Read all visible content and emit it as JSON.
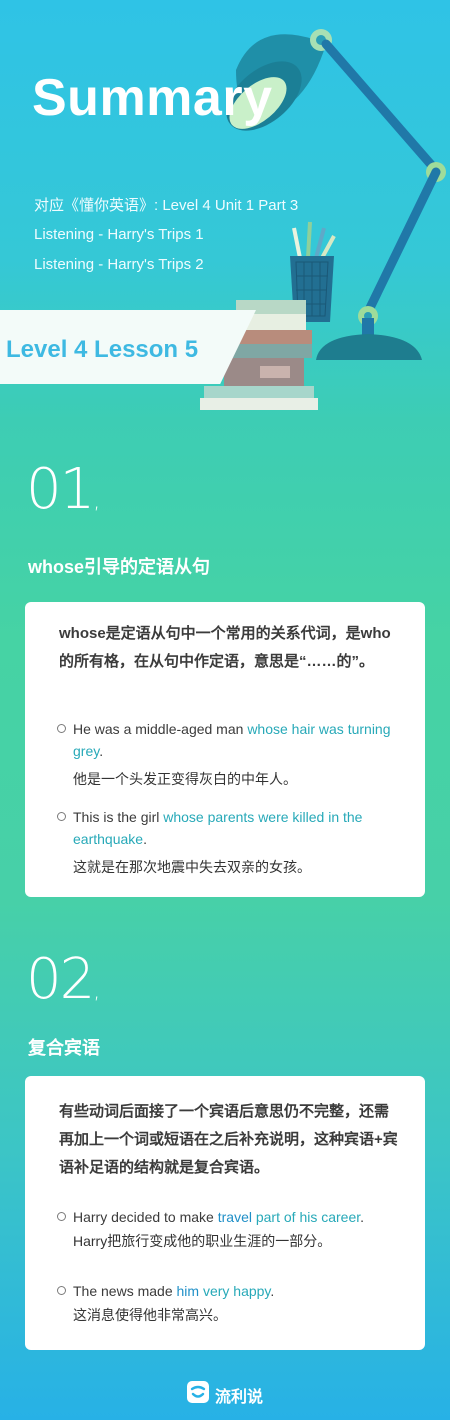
{
  "header": {
    "title": "Summary",
    "course_line": "对应《懂你英语》: Level 4 Unit 1 Part 3",
    "listening_1": "Listening - Harry's Trips 1",
    "listening_2": "Listening - Harry's Trips 2",
    "lesson": "Level 4 Lesson 5"
  },
  "sections": [
    {
      "number": "01",
      "comma": ",",
      "title": "whose引导的定语从句",
      "lead": "whose是定语从句中一个常用的关系代词，是who的所有格，在从句中作定语，意思是“……的”。",
      "examples": [
        {
          "en_before": "He was a middle-aged man ",
          "en_highlight": "whose hair was turning grey",
          "en_after": ".",
          "zh": "他是一个头发正变得灰白的中年人。"
        },
        {
          "en_before": "This is the girl ",
          "en_highlight": "whose parents were killed in the earthquake",
          "en_after": ".",
          "zh": "这就是在那次地震中失去双亲的女孩。"
        }
      ]
    },
    {
      "number": "02",
      "comma": ",",
      "title": "复合宾语",
      "lead": "有些动词后面接了一个宾语后意思仍不完整，还需再加上一个词或短语在之后补充说明，这种宾语+宾语补足语的结构就是复合宾语。",
      "examples": [
        {
          "en_before": "Harry decided to make ",
          "en_obj": "travel",
          "en_mid": " ",
          "en_highlight": "part of his career",
          "en_after": ".",
          "zh": "Harry把旅行变成他的职业生涯的一部分。"
        },
        {
          "en_before": "The news made ",
          "en_obj": "him",
          "en_mid": " ",
          "en_highlight": "very happy",
          "en_after": ".",
          "zh": "这消息使得他非常高兴。"
        }
      ]
    }
  ],
  "footer": {
    "brand": "流利说",
    "logo_icon": "liulishuo-logo-icon"
  },
  "colors": {
    "highlight_teal": "#27a9b8",
    "highlight_blue": "#1f8fc7",
    "lesson_text": "#3eb9e2"
  }
}
